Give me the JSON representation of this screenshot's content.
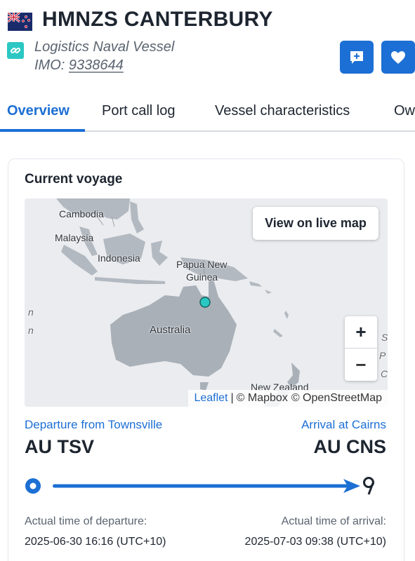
{
  "vessel": {
    "name": "HMNZS CANTERBURY",
    "type": "Logistics Naval Vessel",
    "imo_label": "IMO:",
    "imo": "9338644",
    "flag_icon": "new-zealand-flag-icon"
  },
  "actions": {
    "add_note_icon": "add-note-icon",
    "favorite_icon": "heart-icon"
  },
  "tabs": [
    {
      "label": "Overview",
      "active": true
    },
    {
      "label": "Port call log",
      "active": false
    },
    {
      "label": "Vessel characteristics",
      "active": false
    },
    {
      "label": "Ow",
      "active": false
    }
  ],
  "voyage": {
    "title": "Current voyage",
    "map": {
      "live_map_label": "View on live map",
      "zoom_in": "+",
      "zoom_out": "−",
      "labels": {
        "cambodia": "Cambodia",
        "malaysia": "Malaysia",
        "indonesia": "Indonesia",
        "png_line1": "Papua New",
        "png_line2": "Guinea",
        "australia": "Australia",
        "new_zealand": "New Zealand",
        "edge_n1": "n",
        "edge_n2": "n",
        "edge_s": "S",
        "edge_p": "P",
        "edge_c": "C"
      },
      "attribution": {
        "leaflet": "Leaflet",
        "separator": "|",
        "mapbox": "© Mapbox",
        "osm": "© OpenStreetMap"
      },
      "vessel_marker_color": "#2bc7c3"
    },
    "departure": {
      "label": "Departure from Townsville",
      "code": "AU TSV",
      "time_label": "Actual time of departure:",
      "time": "2025-06-30 16:16 (UTC+10)"
    },
    "arrival": {
      "label": "Arrival at Cairns",
      "code": "AU CNS",
      "time_label": "Actual time of arrival:",
      "time": "2025-07-03 09:38 (UTC+10)"
    },
    "progress_fraction": 1.0
  },
  "colors": {
    "accent": "#1c6fd4",
    "marker": "#2bc7c3",
    "land": "#a9b0b8",
    "water": "#eaecef"
  }
}
